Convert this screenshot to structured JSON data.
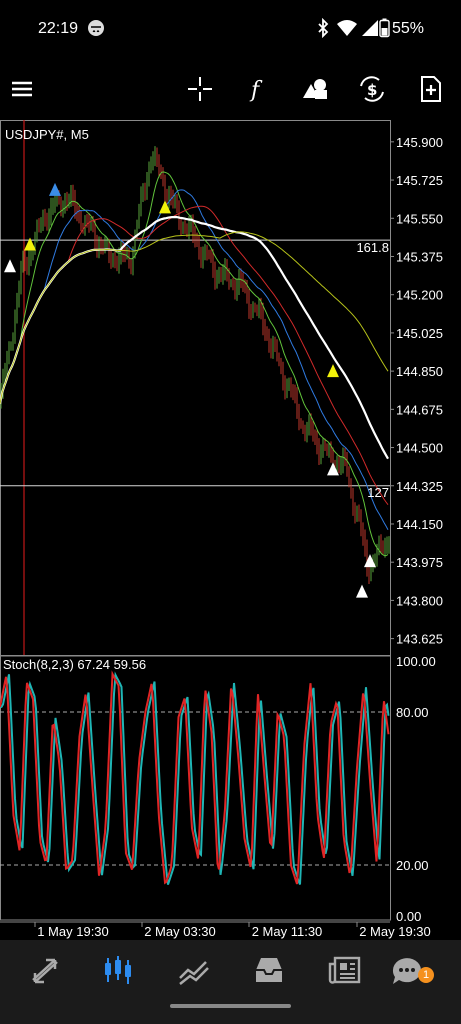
{
  "status": {
    "time": "22:19",
    "battery": "55%",
    "icons": [
      "incognito-icon",
      "bluetooth-icon",
      "wifi-icon",
      "signal-icon",
      "battery-icon"
    ]
  },
  "toolbar": {
    "icons": [
      "menu-icon",
      "crosshair-icon",
      "indicators-icon",
      "objects-icon",
      "symbols-icon",
      "new-order-icon"
    ]
  },
  "chart": {
    "symbol_label": "USDJPY#, M5",
    "price_ticks": [
      "145.900",
      "145.725",
      "145.550",
      "145.375",
      "145.200",
      "145.025",
      "144.850",
      "144.675",
      "144.500",
      "144.325",
      "144.150",
      "143.975",
      "143.800",
      "143.625"
    ],
    "hline_labels": {
      "upper": "161.8",
      "lower": "127"
    },
    "time_labels": [
      "1 May 19:30",
      "2 May 03:30",
      "2 May 11:30",
      "2 May 19:30"
    ],
    "stoch_label": "Stoch(8,2,3) 67.24 59.56",
    "stoch_ticks": [
      "100.00",
      "80.00",
      "20.00",
      "0.00"
    ]
  },
  "colors": {
    "up": "#5aa43c",
    "down": "#c0392b",
    "ma_white": "#ffffff",
    "ma_yellowgreen": "#b6c21a",
    "ma_red": "#d02a2a",
    "ma_blue": "#2f7ae0",
    "ma_green": "#61c33b",
    "stoch_main": "#e02525",
    "stoch_signal": "#1fb5b5",
    "accent": "#2d8cf0"
  },
  "bottom_nav": {
    "items": [
      "quotes-icon",
      "chart-icon",
      "trade-icon",
      "history-icon",
      "news-icon",
      "messages-icon"
    ],
    "active": "chart-icon",
    "badge": "1"
  },
  "chart_data": {
    "type": "line",
    "title": "USDJPY#, M5",
    "x": [
      "1 May 19:30",
      "2 May 03:30",
      "2 May 11:30",
      "2 May 19:30"
    ],
    "ylim": [
      143.55,
      146.0
    ],
    "series": [
      {
        "values": [
          144.7,
          145.3,
          145.55,
          145.65,
          145.52,
          145.38,
          145.36,
          145.85,
          145.6,
          145.45,
          145.3,
          145.25,
          145.1,
          144.85,
          144.6,
          144.48,
          144.4,
          143.95,
          144.1
        ]
      }
    ],
    "stochastic": {
      "label": "Stoch(8,2,3) 67.24 59.56",
      "main": 67.24,
      "signal": 59.56,
      "levels": [
        80,
        20
      ],
      "ylim": [
        0,
        100
      ],
      "values": [
        82,
        95,
        40,
        25,
        92,
        85,
        30,
        20,
        78,
        60,
        18,
        22,
        70,
        88,
        50,
        15,
        35,
        95,
        90,
        25,
        18,
        60,
        80,
        92,
        40,
        12,
        20,
        78,
        86,
        35,
        22,
        90,
        72,
        15,
        40,
        92,
        64,
        30,
        18,
        88,
        55,
        24,
        80,
        70,
        20,
        12,
        66,
        92,
        40,
        22,
        75,
        85,
        30,
        15,
        58,
        90,
        52,
        20,
        86,
        67
      ]
    },
    "horizontal_lines": [
      {
        "label": "161.8",
        "price": 145.45
      },
      {
        "label": "127",
        "price": 144.325
      }
    ]
  }
}
